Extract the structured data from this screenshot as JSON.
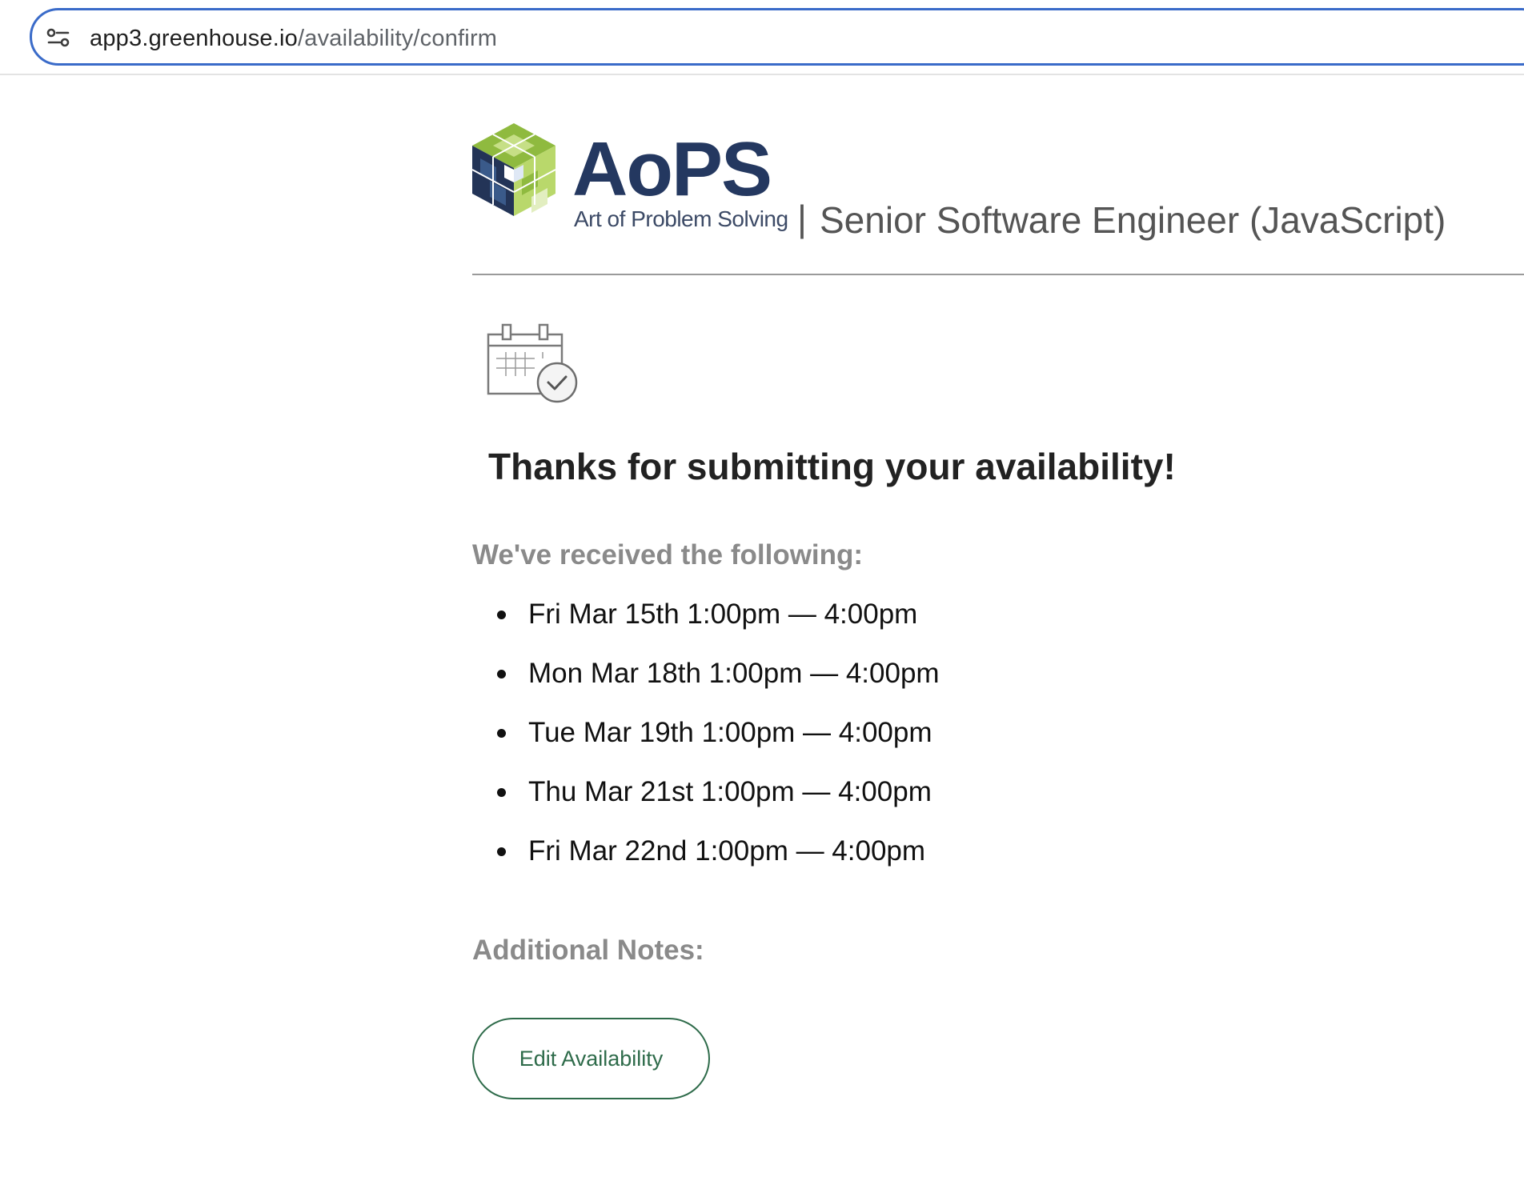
{
  "browser": {
    "url_host": "app3.greenhouse.io",
    "url_path": "/availability/confirm",
    "site_info_icon": "tune-icon",
    "accent_color": "#3a6bc9"
  },
  "header": {
    "logo_text": "AoPS",
    "logo_tagline": "Art of Problem Solving",
    "separator": "|",
    "job_title": "Senior Software Engineer (JavaScript)",
    "logo_icon": "aops-cube-logo",
    "brand_color": "#243860"
  },
  "confirmation": {
    "icon": "calendar-check-icon",
    "heading": "Thanks for submitting your availability!",
    "received_label": "We've received the following:",
    "slots": [
      "Fri Mar 15th 1:00pm — 4:00pm",
      "Mon Mar 18th 1:00pm — 4:00pm",
      "Tue Mar 19th 1:00pm — 4:00pm",
      "Thu Mar 21st 1:00pm — 4:00pm",
      "Fri Mar 22nd 1:00pm — 4:00pm"
    ],
    "notes_label": "Additional Notes:",
    "edit_button_label": "Edit Availability",
    "button_color": "#2e6b4a"
  }
}
